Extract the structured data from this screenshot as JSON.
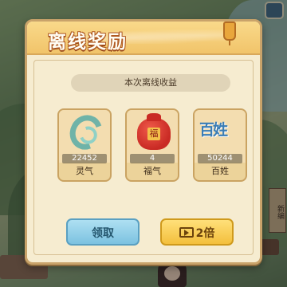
{
  "dialog": {
    "title": "离线奖励",
    "subtitle": "本次离线收益"
  },
  "rewards": [
    {
      "name": "灵气",
      "count": "22452",
      "icon": "spirit-swirl-icon"
    },
    {
      "name": "福气",
      "count": "4",
      "icon": "lucky-bag-icon"
    },
    {
      "name": "百姓",
      "count": "50244",
      "icon": "villagers-icon",
      "icon_text": "百姓"
    }
  ],
  "buttons": {
    "claim_label": "领取",
    "double_label": "2倍"
  },
  "scene": {
    "sign_text": "新编"
  }
}
